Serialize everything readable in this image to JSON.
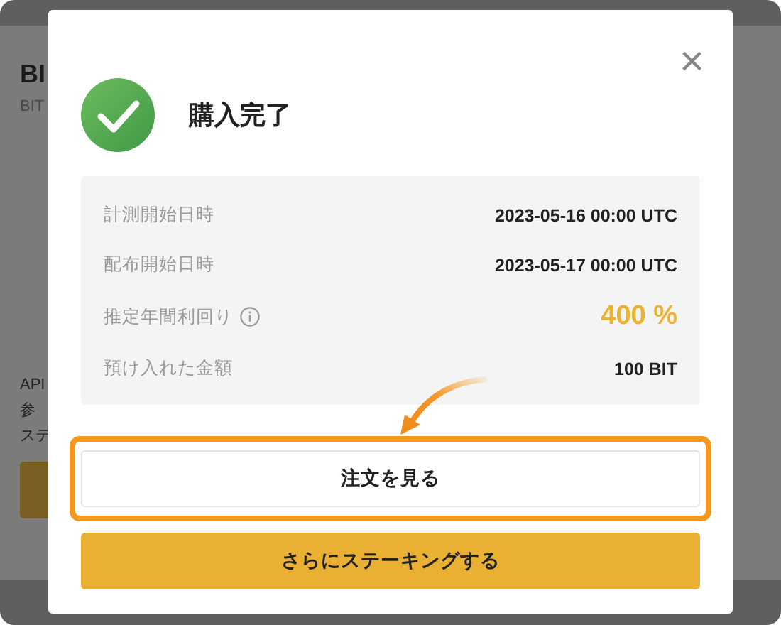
{
  "background_page": {
    "title": "BI",
    "subtitle": "BIT",
    "lines": [
      "API",
      "参",
      "ステ"
    ]
  },
  "dialog": {
    "close": "×",
    "title": "購入完了",
    "details": [
      {
        "label": "計測開始日時",
        "value": "2023-05-16 00:00 UTC",
        "info": false,
        "emphasis": false
      },
      {
        "label": "配布開始日時",
        "value": "2023-05-17 00:00 UTC",
        "info": false,
        "emphasis": false
      },
      {
        "label": "推定年間利回り",
        "value": "400 %",
        "info": true,
        "emphasis": true
      },
      {
        "label": "預け入れた金額",
        "value": "100 BIT",
        "info": false,
        "emphasis": false
      }
    ],
    "buttons": [
      {
        "label": "注文を見る",
        "kind": "secondary",
        "highlighted": true
      },
      {
        "label": "さらにステーキングする",
        "kind": "primary",
        "highlighted": false
      }
    ]
  }
}
